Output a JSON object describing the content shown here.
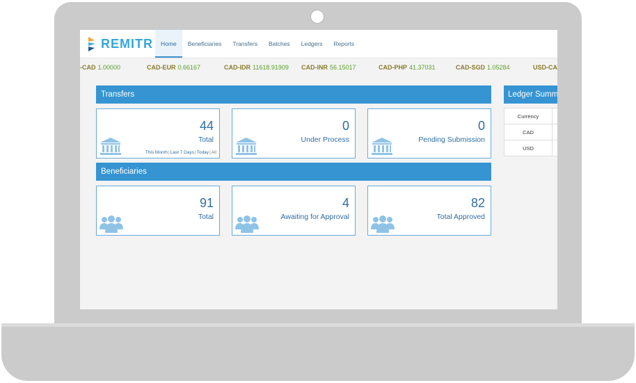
{
  "app": {
    "logo_text": "REMITR"
  },
  "nav": {
    "items": [
      {
        "label": "Home",
        "active": true
      },
      {
        "label": "Beneficiaries",
        "active": false
      },
      {
        "label": "Transfers",
        "active": false
      },
      {
        "label": "Batches",
        "active": false
      },
      {
        "label": "Ledgers",
        "active": false
      },
      {
        "label": "Reports",
        "active": false
      }
    ]
  },
  "ticker": {
    "rates": [
      {
        "pair": "-CAD",
        "value": "1.00000"
      },
      {
        "pair": "CAD-EUR",
        "value": "0.66167"
      },
      {
        "pair": "CAD-IDR",
        "value": "11618.91909"
      },
      {
        "pair": "CAD-INR",
        "value": "56.15017"
      },
      {
        "pair": "CAD-PHP",
        "value": "41.37031"
      },
      {
        "pair": "CAD-SGD",
        "value": "1.05284"
      },
      {
        "pair": "USD-CA",
        "value": ""
      }
    ]
  },
  "transfers": {
    "title": "Transfers",
    "cards": [
      {
        "count": "44",
        "label": "Total"
      },
      {
        "count": "0",
        "label": "Under Process"
      },
      {
        "count": "0",
        "label": "Pending Submission"
      }
    ],
    "filters": [
      "This Month",
      "Last 7 Days",
      "Today",
      "All"
    ],
    "filter_sep": "|"
  },
  "beneficiaries": {
    "title": "Beneficiaries",
    "cards": [
      {
        "count": "91",
        "label": "Total"
      },
      {
        "count": "4",
        "label": "Awaiting for Approval"
      },
      {
        "count": "82",
        "label": "Total Approved"
      }
    ]
  },
  "ledger": {
    "title": "Ledger Summa",
    "header": "Currency",
    "rows": [
      "CAD",
      "USD"
    ]
  },
  "colors": {
    "accent": "#3594d1",
    "logo": "#35a7d9",
    "icon": "#8fc3e6",
    "rate_pair": "#8a7a2e",
    "rate_value": "#5aa02c"
  },
  "icons": {
    "transfer": "bank-icon",
    "beneficiary": "users-group-icon"
  }
}
